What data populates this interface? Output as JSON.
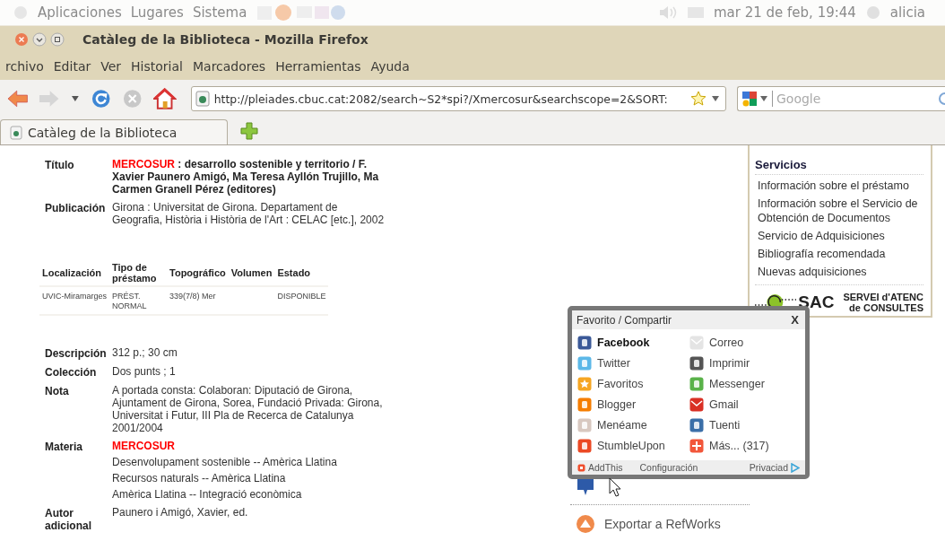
{
  "desktop_panel": {
    "menus": [
      "Aplicaciones",
      "Lugares",
      "Sistema"
    ],
    "clock": "mar 21 de feb, 19:44",
    "user": "alicia"
  },
  "window": {
    "title": "Catàleg de la Biblioteca - Mozilla Firefox"
  },
  "menu_bar": [
    "rchivo",
    "Editar",
    "Ver",
    "Historial",
    "Marcadores",
    "Herramientas",
    "Ayuda"
  ],
  "address_bar": {
    "value": "http://pleiades.cbuc.cat:2082/search~S2*spi?/Xmercosur&searchscope=2&SORT:"
  },
  "search_bar": {
    "placeholder": "Google"
  },
  "tabs": [
    {
      "label": "Catàleg de la Biblioteca",
      "selected": true
    }
  ],
  "record_top": [
    {
      "label": "Título",
      "kind": "title",
      "keyword": "MERCOSUR",
      "value": " : desarrollo sostenible y territorio / F. Xavier Paunero Amigó, Ma Teresa Ayllón Trujillo, Ma Carmen Granell Pérez (editores)"
    },
    {
      "label": "Publicación",
      "kind": "plain",
      "value": "Girona : Universitat de Girona. Departament de Geografia, Història i Història de l'Art : CELAC [etc.], 2002"
    }
  ],
  "holdings": {
    "columns": [
      "Localización",
      "Tipo de préstamo",
      "Topográfico",
      "Volumen",
      "Estado"
    ],
    "rows": [
      [
        "UVIC-Miramarges",
        "PRÉST. NORMAL",
        "339(7/8) Mer",
        "",
        "DISPONIBLE"
      ]
    ]
  },
  "record_bottom": [
    {
      "label": "Descripción",
      "values": [
        {
          "text": "312 p.; 30 cm",
          "link": false
        }
      ]
    },
    {
      "label": "Colección",
      "values": [
        {
          "text": "Dos punts ; 1",
          "link": false
        }
      ]
    },
    {
      "label": "Nota",
      "values": [
        {
          "text": "A portada consta: Colaboran: Diputació de Girona, Ajuntament de Girona, Sorea, Fundació Privada: Girona, Universitat i Futur, III Pla de Recerca de Catalunya 2001/2004",
          "link": false
        }
      ]
    },
    {
      "label": "Materia",
      "values": [
        {
          "text": "MERCOSUR",
          "link": true
        },
        {
          "text": "Desenvolupament sostenible -- Amèrica Llatina",
          "link": false
        },
        {
          "text": "Recursos naturals -- Amèrica Llatina",
          "link": false
        },
        {
          "text": "Amèrica Llatina -- Integració econòmica",
          "link": false
        }
      ]
    },
    {
      "label": "Autor adicional",
      "values": [
        {
          "text": "Paunero i Amigó, Xavier, ed.",
          "link": false
        }
      ]
    }
  ],
  "share_popup": {
    "title": "Favorito / Compartir",
    "close": "X",
    "services": [
      {
        "label": "Facebook",
        "kind": "facebook",
        "selected": true
      },
      {
        "label": "Correo",
        "kind": "mail",
        "selected": false
      },
      {
        "label": "Twitter",
        "kind": "twitter",
        "selected": false
      },
      {
        "label": "Imprimir",
        "kind": "print",
        "selected": false
      },
      {
        "label": "Favoritos",
        "kind": "favorites",
        "selected": false
      },
      {
        "label": "Messenger",
        "kind": "messenger",
        "selected": false
      },
      {
        "label": "Blogger",
        "kind": "blogger",
        "selected": false
      },
      {
        "label": "Gmail",
        "kind": "gmail",
        "selected": false
      },
      {
        "label": "Menéame",
        "kind": "meneame",
        "selected": false
      },
      {
        "label": "Tuenti",
        "kind": "tuenti",
        "selected": false
      },
      {
        "label": "StumbleUpon",
        "kind": "stumbleupon",
        "selected": false
      },
      {
        "label": "Más... (317)",
        "kind": "more",
        "selected": false
      }
    ],
    "footer": {
      "brand": "AddThis",
      "settings": "Configuración",
      "privacy": "Privaciad"
    }
  },
  "actions": [
    {
      "kind": "share"
    },
    {
      "label": "Exportar a RefWorks",
      "kind": "export"
    }
  ],
  "sidebar": {
    "heading": "Servicios",
    "links": [
      "Información sobre el préstamo",
      "Información sobre el Servicio de Obtención de Documentos",
      "Servicio de Adquisiciones",
      "Bibliografía recomendada",
      "Nuevas adquisiciones"
    ],
    "banner": {
      "logo": "SAC",
      "line_1": "SERVEI d'ATENC",
      "line_2": "de CONSULTES"
    }
  }
}
